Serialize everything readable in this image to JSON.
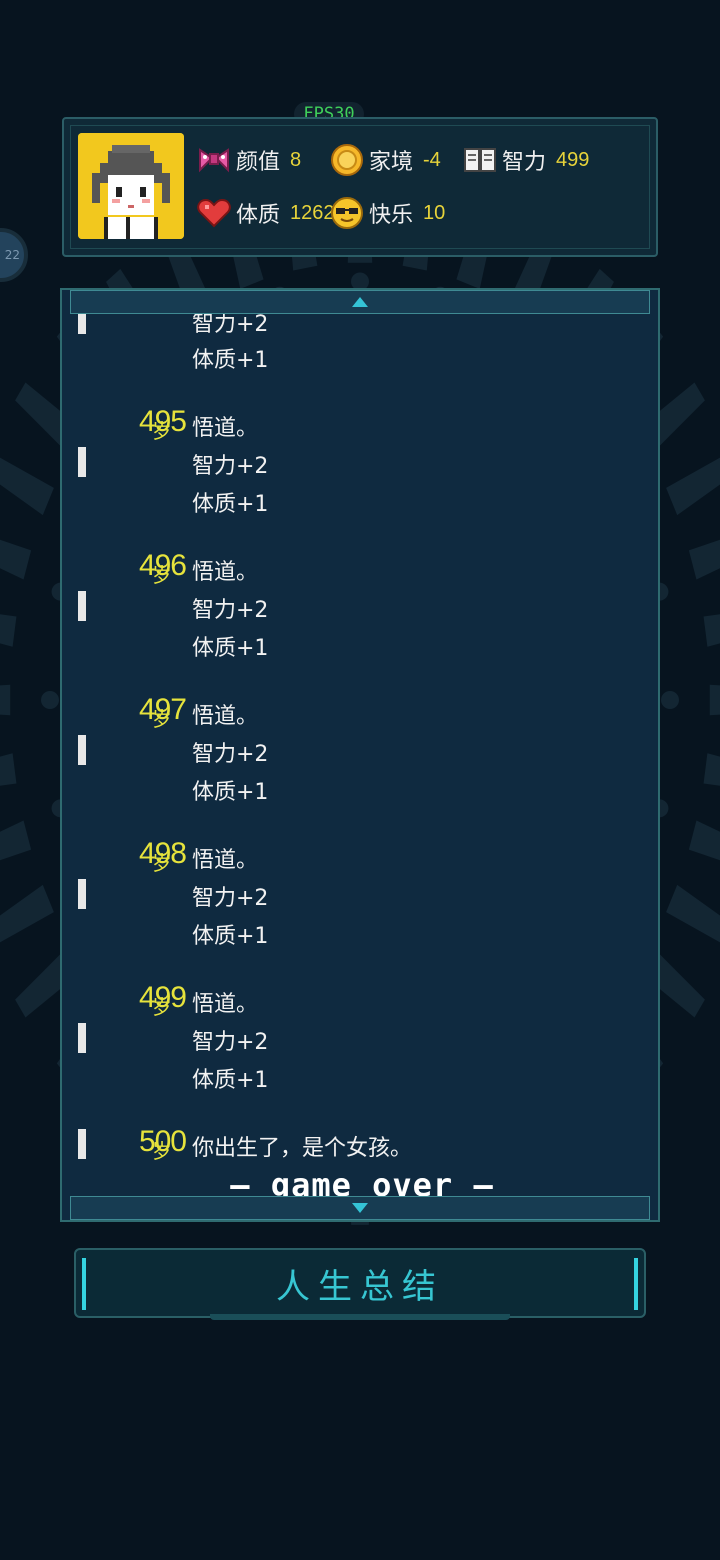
{
  "fps_label": "FPS30",
  "stats": [
    {
      "icon": "bow-icon",
      "label": "颜值",
      "value": "8"
    },
    {
      "icon": "coin-icon",
      "label": "家境",
      "value": "-4"
    },
    {
      "icon": "book-icon",
      "label": "智力",
      "value": "499"
    },
    {
      "icon": "heart-icon",
      "label": "体质",
      "value": "1262"
    },
    {
      "icon": "sunglasses-face-icon",
      "label": "快乐",
      "value": "10"
    }
  ],
  "side_button_label": "22",
  "log": {
    "partial_top_lines": [
      "智力+2",
      "体质+1"
    ],
    "entries": [
      {
        "age": "495",
        "unit": "岁",
        "lines": [
          "悟道。",
          "智力+2",
          "体质+1"
        ]
      },
      {
        "age": "496",
        "unit": "岁",
        "lines": [
          "悟道。",
          "智力+2",
          "体质+1"
        ]
      },
      {
        "age": "497",
        "unit": "岁",
        "lines": [
          "悟道。",
          "智力+2",
          "体质+1"
        ]
      },
      {
        "age": "498",
        "unit": "岁",
        "lines": [
          "悟道。",
          "智力+2",
          "体质+1"
        ]
      },
      {
        "age": "499",
        "unit": "岁",
        "lines": [
          "悟道。",
          "智力+2",
          "体质+1"
        ]
      },
      {
        "age": "500",
        "unit": "岁",
        "lines": [
          "你出生了，是个女孩。"
        ]
      }
    ],
    "game_over": "— game over —"
  },
  "summary_button": "人生总结",
  "colors": {
    "background": "#07141f",
    "age_yellow": "#e6e33c",
    "accent_cyan": "#37c6d2",
    "fps_green": "#3fd05a"
  }
}
